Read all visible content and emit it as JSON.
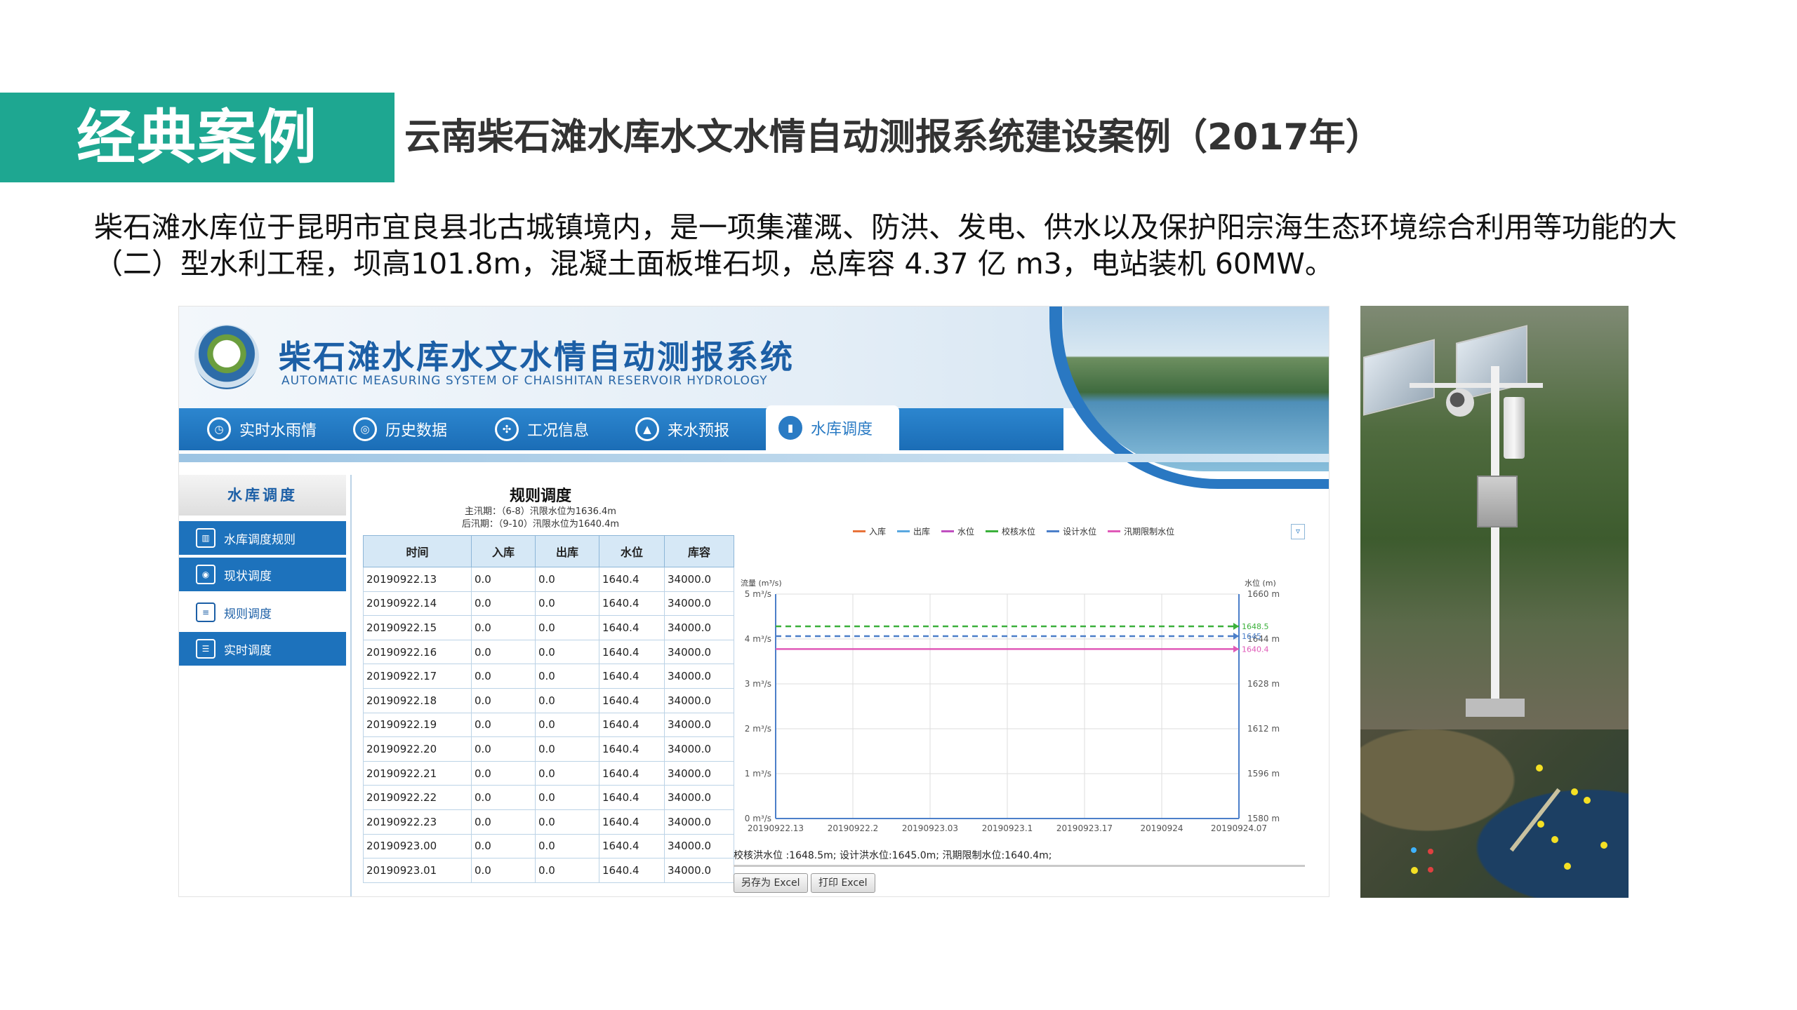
{
  "slide": {
    "badge": "经典案例",
    "title": "云南柴石滩水库水文水情自动测报系统建设案例（2017年）",
    "description": "柴石滩水库位于昆明市宜良县北古城镇境内，是一项集灌溉、防洪、发电、供水以及保护阳宗海生态环境综合利用等功能的大（二）型水利工程，坝高101.8m，混凝土面板堆石坝，总库容 4.37 亿 m3，电站装机 60MW。",
    "accent_color": "#1ea791"
  },
  "app": {
    "title": "柴石滩水库水文水情自动测报系统",
    "subtitle": "AUTOMATIC MEASURING SYSTEM OF CHAISHITAN RESERVOIR HYDROLOGY",
    "nav": [
      {
        "label": "实时水雨情",
        "icon": "clock-icon"
      },
      {
        "label": "历史数据",
        "icon": "target-icon"
      },
      {
        "label": "工况信息",
        "icon": "fan-icon"
      },
      {
        "label": "来水预报",
        "icon": "drop-icon"
      },
      {
        "label": "水库调度",
        "icon": "chart-icon",
        "active": true
      }
    ],
    "sidebar": {
      "header": "水库调度",
      "items": [
        {
          "label": "水库调度规则",
          "icon": "bar-chart-icon"
        },
        {
          "label": "现状调度",
          "icon": "gauge-icon"
        },
        {
          "label": "规则调度",
          "icon": "document-icon",
          "selected": true
        },
        {
          "label": "实时调度",
          "icon": "layers-icon"
        }
      ]
    },
    "table": {
      "title": "规则调度",
      "note1": "主汛期：（6-8）汛限水位为1636.4m",
      "note2": "后汛期：（9-10）汛限水位为1640.4m",
      "columns": [
        "时间",
        "入库",
        "出库",
        "水位",
        "库容"
      ],
      "rows": [
        [
          "20190922.13",
          "0.0",
          "0.0",
          "1640.4",
          "34000.0"
        ],
        [
          "20190922.14",
          "0.0",
          "0.0",
          "1640.4",
          "34000.0"
        ],
        [
          "20190922.15",
          "0.0",
          "0.0",
          "1640.4",
          "34000.0"
        ],
        [
          "20190922.16",
          "0.0",
          "0.0",
          "1640.4",
          "34000.0"
        ],
        [
          "20190922.17",
          "0.0",
          "0.0",
          "1640.4",
          "34000.0"
        ],
        [
          "20190922.18",
          "0.0",
          "0.0",
          "1640.4",
          "34000.0"
        ],
        [
          "20190922.19",
          "0.0",
          "0.0",
          "1640.4",
          "34000.0"
        ],
        [
          "20190922.20",
          "0.0",
          "0.0",
          "1640.4",
          "34000.0"
        ],
        [
          "20190922.21",
          "0.0",
          "0.0",
          "1640.4",
          "34000.0"
        ],
        [
          "20190922.22",
          "0.0",
          "0.0",
          "1640.4",
          "34000.0"
        ],
        [
          "20190922.23",
          "0.0",
          "0.0",
          "1640.4",
          "34000.0"
        ],
        [
          "20190923.00",
          "0.0",
          "0.0",
          "1640.4",
          "34000.0"
        ],
        [
          "20190923.01",
          "0.0",
          "0.0",
          "1640.4",
          "34000.0"
        ]
      ]
    },
    "chart": {
      "legend": [
        {
          "label": "入库",
          "color": "#e8733a"
        },
        {
          "label": "出库",
          "color": "#5aa8e0"
        },
        {
          "label": "水位",
          "color": "#c04fc0"
        },
        {
          "label": "校核水位",
          "color": "#3bb03b"
        },
        {
          "label": "设计水位",
          "color": "#4c7fc9"
        },
        {
          "label": "汛期限制水位",
          "color": "#e05ab8"
        }
      ],
      "left_axis_label": "流量 (m³/s)",
      "right_axis_label": "水位 (m)",
      "left_ticks": [
        "0 m³/s",
        "1 m³/s",
        "2 m³/s",
        "3 m³/s",
        "4 m³/s",
        "5 m³/s"
      ],
      "right_ticks": [
        "1580 m",
        "1596 m",
        "1612 m",
        "1628 m",
        "1644 m",
        "1660 m"
      ],
      "x_ticks": [
        "20190922.13",
        "20190922.2",
        "20190923.03",
        "20190923.1",
        "20190923.17",
        "20190924",
        "20190924.07"
      ],
      "limits_text": "校核洪水位 :1648.5m; 设计洪水位:1645.0m; 汛期限制水位:1640.4m;",
      "buttons": [
        "另存为 Excel",
        "打印 Excel"
      ]
    }
  },
  "chart_data": {
    "type": "line",
    "title": "",
    "legend_placement": "top",
    "xlabel": "",
    "ylabel": "流量 (m³/s)",
    "y2label": "水位 (m)",
    "x": [
      "20190922.13",
      "20190922.2",
      "20190923.03",
      "20190923.1",
      "20190923.17",
      "20190924",
      "20190924.07"
    ],
    "ylim": [
      0,
      5
    ],
    "y2lim": [
      1580,
      1660
    ],
    "grid": true,
    "series": [
      {
        "name": "校核水位",
        "axis": "right",
        "values": [
          1648.5,
          1648.5,
          1648.5,
          1648.5,
          1648.5,
          1648.5,
          1648.5
        ],
        "color": "#3bb03b",
        "style": "dashed",
        "point_label": "1648.5"
      },
      {
        "name": "设计水位",
        "axis": "right",
        "values": [
          1645.0,
          1645.0,
          1645.0,
          1645.0,
          1645.0,
          1645.0,
          1645.0
        ],
        "color": "#4c7fc9",
        "style": "dashed",
        "point_label": "1645"
      },
      {
        "name": "汛期限制水位",
        "axis": "right",
        "values": [
          1640.4,
          1640.4,
          1640.4,
          1640.4,
          1640.4,
          1640.4,
          1640.4
        ],
        "color": "#e05ab8",
        "style": "solid",
        "point_label": "1640.4"
      }
    ]
  }
}
